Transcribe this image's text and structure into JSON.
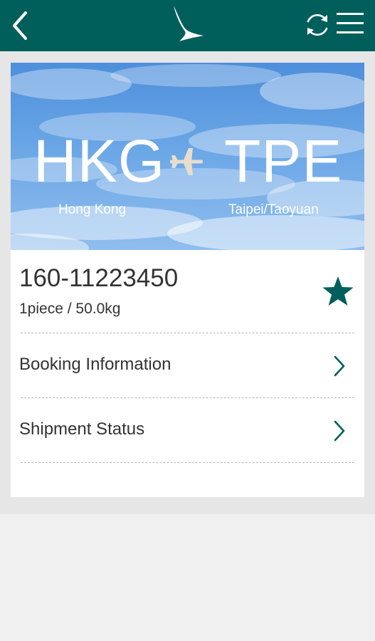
{
  "header": {
    "back_icon": "back-chevron-icon",
    "logo_icon": "brushwing-logo-icon",
    "refresh_icon": "refresh-icon",
    "menu_icon": "hamburger-menu-icon",
    "background_color": "#005f5b"
  },
  "route": {
    "origin_code": "HKG",
    "origin_city": "Hong Kong",
    "destination_code": "TPE",
    "destination_city": "Taipei/Taoyuan",
    "separator_icon": "airplane-icon"
  },
  "shipment": {
    "awb_number": "160-11223450",
    "summary": "1piece / 50.0kg",
    "favorite_icon": "star-icon",
    "accent_color": "#005f5b"
  },
  "menu_items": [
    {
      "label": "Booking Information"
    },
    {
      "label": "Shipment Status"
    }
  ]
}
